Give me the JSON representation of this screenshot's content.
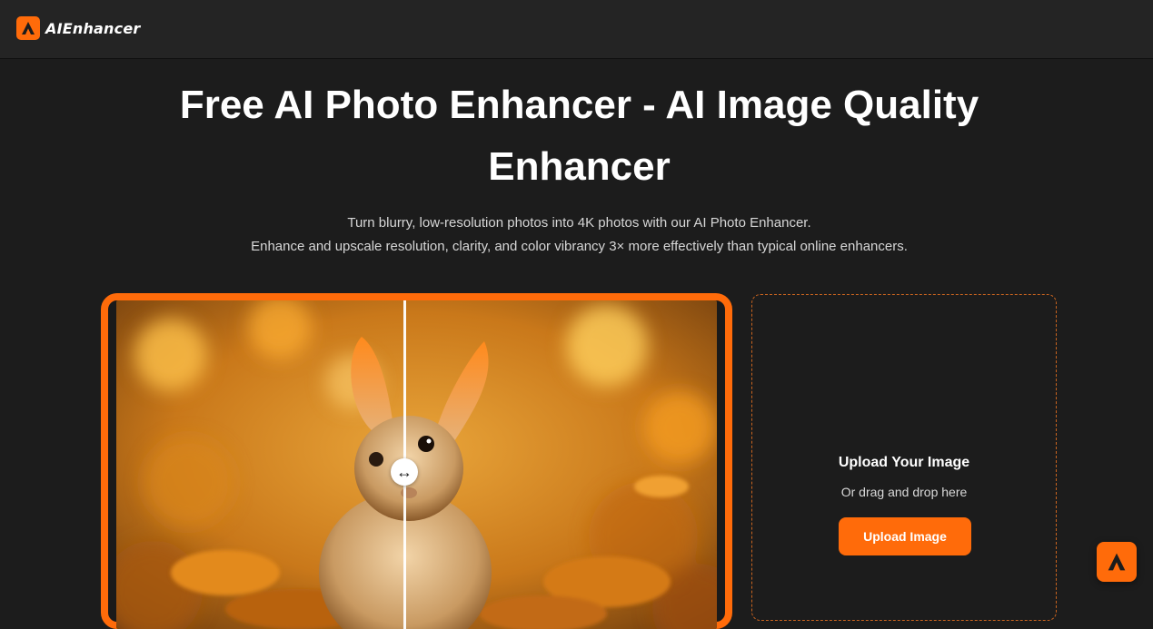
{
  "header": {
    "logo_text_main": "AI",
    "logo_text_accent": "Enhancer",
    "logo_icon": "ai-enhancer-logo-icon"
  },
  "hero": {
    "title": "Free AI Photo Enhancer - AI Image Quality Enhancer",
    "subtitle_line1": "Turn blurry, low-resolution photos into 4K photos with our AI Photo Enhancer.",
    "subtitle_line2": "Enhance and upscale resolution, clarity, and color vibrancy 3× more effectively than typical online enhancers."
  },
  "comparison": {
    "handle_icon": "horizontal-arrows-icon",
    "handle_glyph": "↔",
    "split_position": 0.48
  },
  "upload": {
    "title": "Upload Your Image",
    "hint": "Or drag and drop here",
    "button_label": "Upload Image"
  },
  "floating": {
    "icon": "ai-enhancer-logo-icon"
  },
  "colors": {
    "accent": "#ff6b0a",
    "background": "#1c1c1c",
    "header": "#242424"
  }
}
